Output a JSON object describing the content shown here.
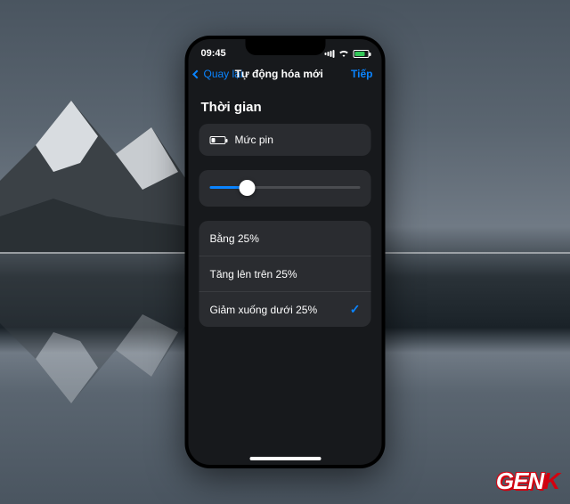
{
  "status": {
    "time": "09:45"
  },
  "nav": {
    "back": "Quay lại",
    "title": "Tự động hóa mới",
    "next": "Tiếp"
  },
  "section_title": "Thời gian",
  "battery_row": {
    "label": "Mức pin"
  },
  "slider": {
    "value_percent": 25
  },
  "options": [
    {
      "label": "Bằng 25%",
      "selected": false
    },
    {
      "label": "Tăng lên trên 25%",
      "selected": false
    },
    {
      "label": "Giảm xuống dưới 25%",
      "selected": true
    }
  ],
  "watermark": {
    "prefix": "GEN",
    "suffix": "K"
  }
}
